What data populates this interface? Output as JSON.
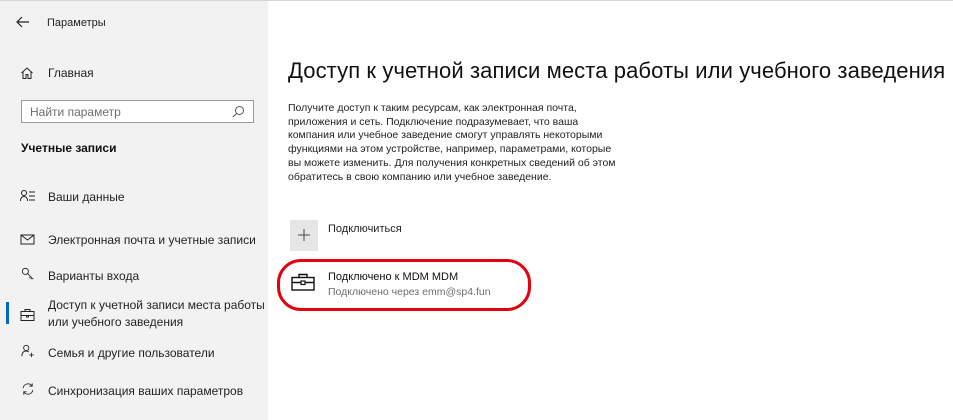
{
  "app": {
    "title": "Параметры"
  },
  "sidebar": {
    "home_label": "Главная",
    "search_placeholder": "Найти параметр",
    "section_title": "Учетные записи",
    "items": [
      {
        "label": "Ваши данные",
        "icon": "person-list-icon"
      },
      {
        "label": "Электронная почта и учетные записи",
        "icon": "mail-icon"
      },
      {
        "label": "Варианты входа",
        "icon": "key-icon"
      },
      {
        "label": "Доступ к учетной записи места работы",
        "label2": "или учебного заведения",
        "icon": "briefcase-icon",
        "selected": true
      },
      {
        "label": "Семья и другие пользователи",
        "icon": "person-add-icon"
      },
      {
        "label": "Синхронизация ваших параметров",
        "icon": "sync-icon"
      }
    ]
  },
  "main": {
    "title": "Доступ к учетной записи места работы или учебного заведения",
    "description": [
      "Получите доступ к таким ресурсам, как электронная почта,",
      "приложения и сеть. Подключение подразумевает, что ваша",
      "компания или учебное заведение смогут управлять некоторыми",
      "функциями на этом устройстве, например, параметрами, которые",
      "вы можете изменить. Для получения конкретных сведений об этом",
      "обратитесь в свою компанию или учебное заведение."
    ],
    "connect_label": "Подключиться",
    "account": {
      "title": "Подключено к MDM MDM",
      "subtitle": "Подключено через emm@sp4.fun"
    }
  },
  "colors": {
    "accent": "#0067c0",
    "highlight": "#e3000f",
    "sidebar_bg": "#f2f2f2"
  }
}
